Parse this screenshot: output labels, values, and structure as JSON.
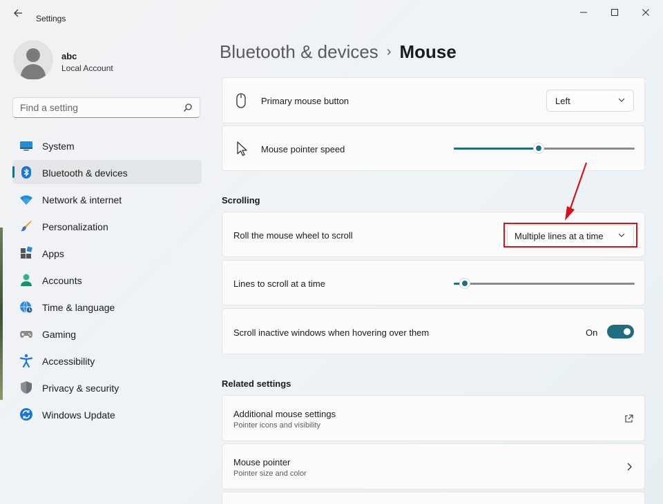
{
  "window": {
    "title": "Settings",
    "back_icon": "back-arrow-icon"
  },
  "controls": {
    "minimize": "—",
    "maximize": "□",
    "close": "✕"
  },
  "account": {
    "name": "abc",
    "type": "Local Account"
  },
  "search": {
    "placeholder": "Find a setting"
  },
  "nav": {
    "items": [
      {
        "label": "System",
        "icon": "system-icon"
      },
      {
        "label": "Bluetooth & devices",
        "icon": "bluetooth-icon",
        "selected": true
      },
      {
        "label": "Network & internet",
        "icon": "wifi-icon"
      },
      {
        "label": "Personalization",
        "icon": "brush-icon"
      },
      {
        "label": "Apps",
        "icon": "apps-icon"
      },
      {
        "label": "Accounts",
        "icon": "accounts-icon"
      },
      {
        "label": "Time & language",
        "icon": "globe-clock-icon"
      },
      {
        "label": "Gaming",
        "icon": "gamepad-icon"
      },
      {
        "label": "Accessibility",
        "icon": "accessibility-icon"
      },
      {
        "label": "Privacy & security",
        "icon": "shield-icon"
      },
      {
        "label": "Windows Update",
        "icon": "update-icon"
      }
    ]
  },
  "header": {
    "parent": "Bluetooth & devices",
    "separator": "›",
    "current": "Mouse"
  },
  "settings": {
    "primary_button": {
      "label": "Primary mouse button",
      "value": "Left",
      "icon": "mouse-icon"
    },
    "pointer_speed": {
      "label": "Mouse pointer speed",
      "icon": "pointer-icon",
      "level": 0.47
    },
    "scrolling_title": "Scrolling",
    "roll_wheel": {
      "label": "Roll the mouse wheel to scroll",
      "value": "Multiple lines at a time"
    },
    "lines_to_scroll": {
      "label": "Lines to scroll at a time",
      "level": 0.06
    },
    "scroll_inactive": {
      "label": "Scroll inactive windows when hovering over them",
      "state": "On"
    }
  },
  "related": {
    "title": "Related settings",
    "items": [
      {
        "label": "Additional mouse settings",
        "sub": "Pointer icons and visibility",
        "icon": "external-link-icon"
      },
      {
        "label": "Mouse pointer",
        "sub": "Pointer size and color",
        "icon": "chevron-right-icon"
      }
    ]
  },
  "colors": {
    "accent": "#1f6e7f",
    "highlight": "#d3121c"
  }
}
